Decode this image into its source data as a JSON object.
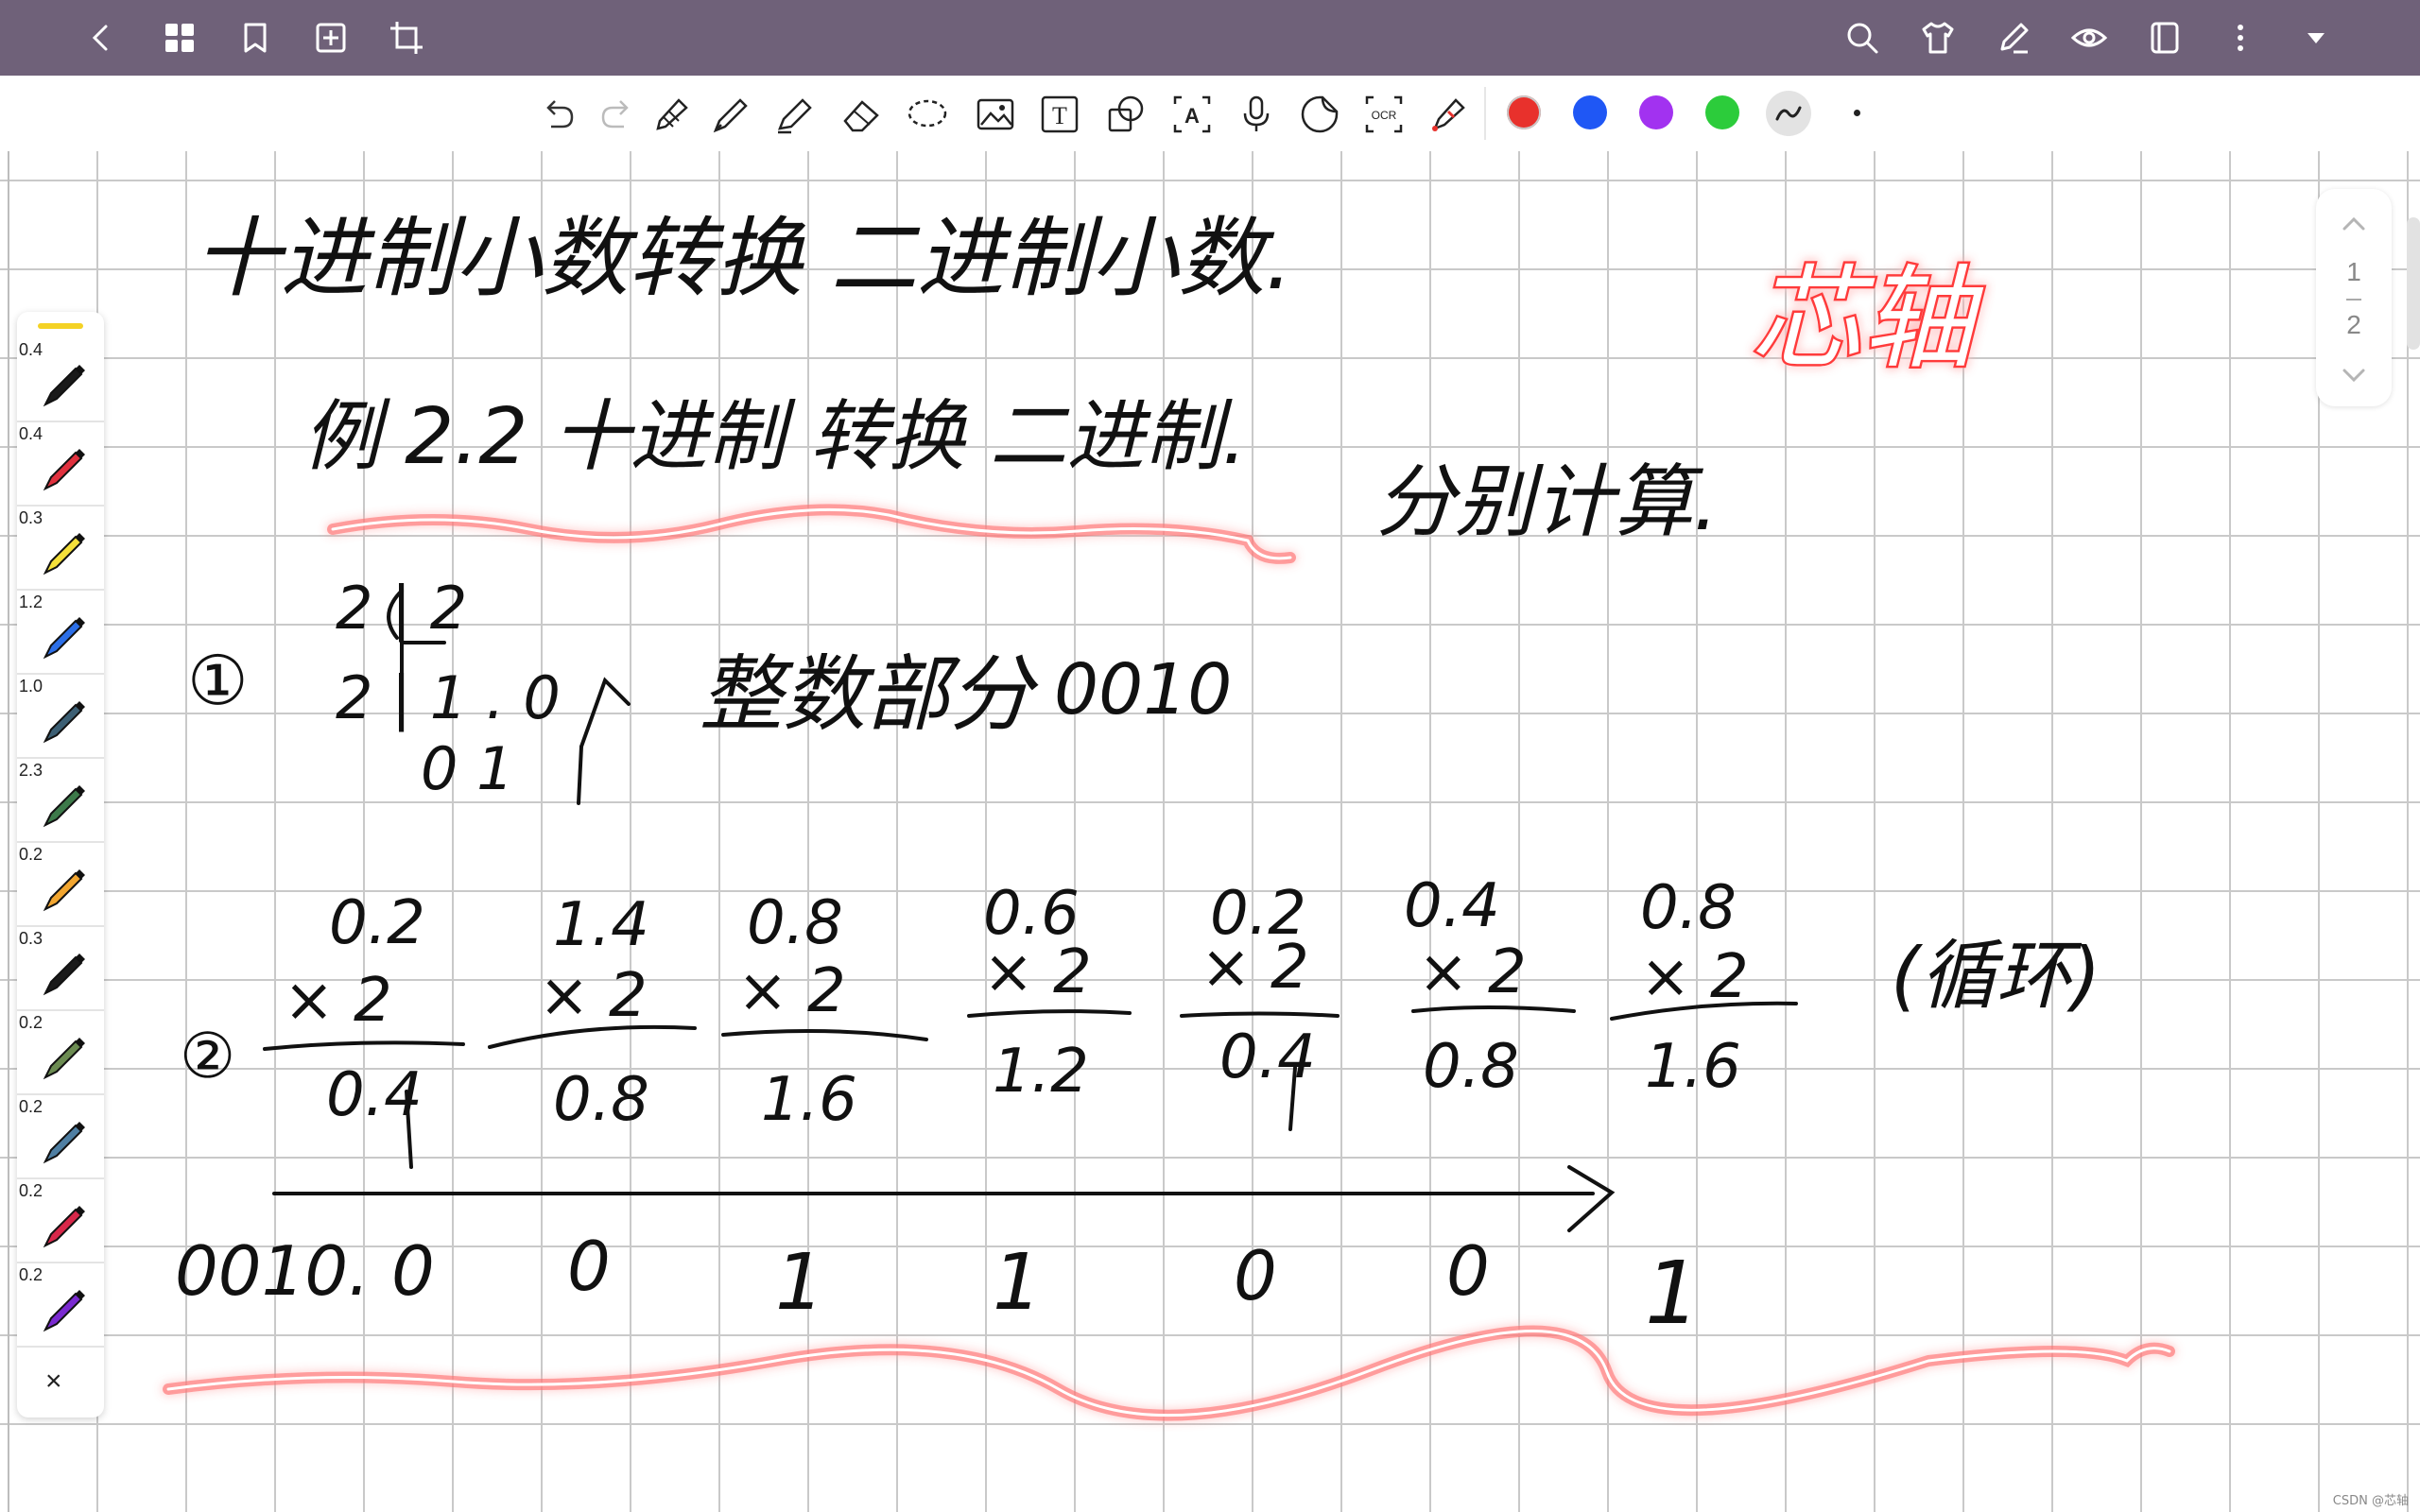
{
  "topbar": {
    "left_icons": [
      "back-icon",
      "grid-icon",
      "bookmark-icon",
      "add-page-icon",
      "crop-icon"
    ],
    "right_icons": [
      "search-icon",
      "shirt-icon",
      "pen-edit-icon",
      "eye-icon",
      "notebook-icon",
      "more-icon",
      "dropdown-icon"
    ]
  },
  "toolbar": {
    "tools": [
      "undo-icon",
      "redo-icon",
      "pencil-icon",
      "pen-icon",
      "highlighter-icon",
      "eraser-icon",
      "lasso-icon",
      "image-icon",
      "text-icon",
      "shape-icon",
      "text-recognition-icon",
      "microphone-icon",
      "sticker-icon",
      "ocr-icon",
      "laser-pointer-icon"
    ],
    "ocr_label": "OCR",
    "text_icon_label": "T",
    "text_recognition_label": "A",
    "colors": [
      "#e8312c",
      "#1f57f5",
      "#a232f0",
      "#2ccc3b"
    ],
    "active_stroke": "stroke-style-icon"
  },
  "pen_tray": {
    "pens": [
      {
        "size": "0.4",
        "color": "#1a1a1a"
      },
      {
        "size": "0.4",
        "color": "#e0313e"
      },
      {
        "size": "0.3",
        "color": "#f4e03a"
      },
      {
        "size": "1.2",
        "color": "#2c6fe8"
      },
      {
        "size": "1.0",
        "color": "#3c5f74"
      },
      {
        "size": "2.3",
        "color": "#3d7a4a"
      },
      {
        "size": "0.2",
        "color": "#f2a630"
      },
      {
        "size": "0.3",
        "color": "#1a1a1a"
      },
      {
        "size": "0.2",
        "color": "#6c8c52"
      },
      {
        "size": "0.2",
        "color": "#4f7fa3"
      },
      {
        "size": "0.2",
        "color": "#d8284a"
      },
      {
        "size": "0.2",
        "color": "#7a2ad0"
      }
    ],
    "close_label": "×"
  },
  "page_nav": {
    "current": "1",
    "total": "2"
  },
  "handwriting": {
    "title": "十进制小数转换 二进制小数.",
    "example": "例  2.2 十进制 转换 二进制.",
    "side_note": "分别计算.",
    "red_signature": "芯轴",
    "step1_marker": "①",
    "step1_division": [
      "2 | 2",
      "2 | 1 . 0",
      "0   1"
    ],
    "step1_label": "整数部分",
    "step1_result": "0010",
    "step2_marker": "②",
    "step2_multiplications": [
      {
        "top": "0.2",
        "mult": "× 2",
        "result": "0.4"
      },
      {
        "top": "1.4",
        "mult": "× 2",
        "result": "0.8"
      },
      {
        "top": "0.8",
        "mult": "× 2",
        "result": "1.6"
      },
      {
        "top": "0.6",
        "mult": "× 2",
        "result": "1.2"
      },
      {
        "top": "0.2",
        "mult": "× 2",
        "result": "0.4"
      },
      {
        "top": "0.4",
        "mult": "× 2",
        "result": "0.8"
      },
      {
        "top": "0.8",
        "mult": "× 2",
        "result": "1.6"
      }
    ],
    "loop_label": "(循环)",
    "final_digits": [
      "0010. 0",
      "0",
      "1",
      "1",
      "0",
      "0",
      "1"
    ]
  },
  "watermark": "CSDN @芯轴"
}
